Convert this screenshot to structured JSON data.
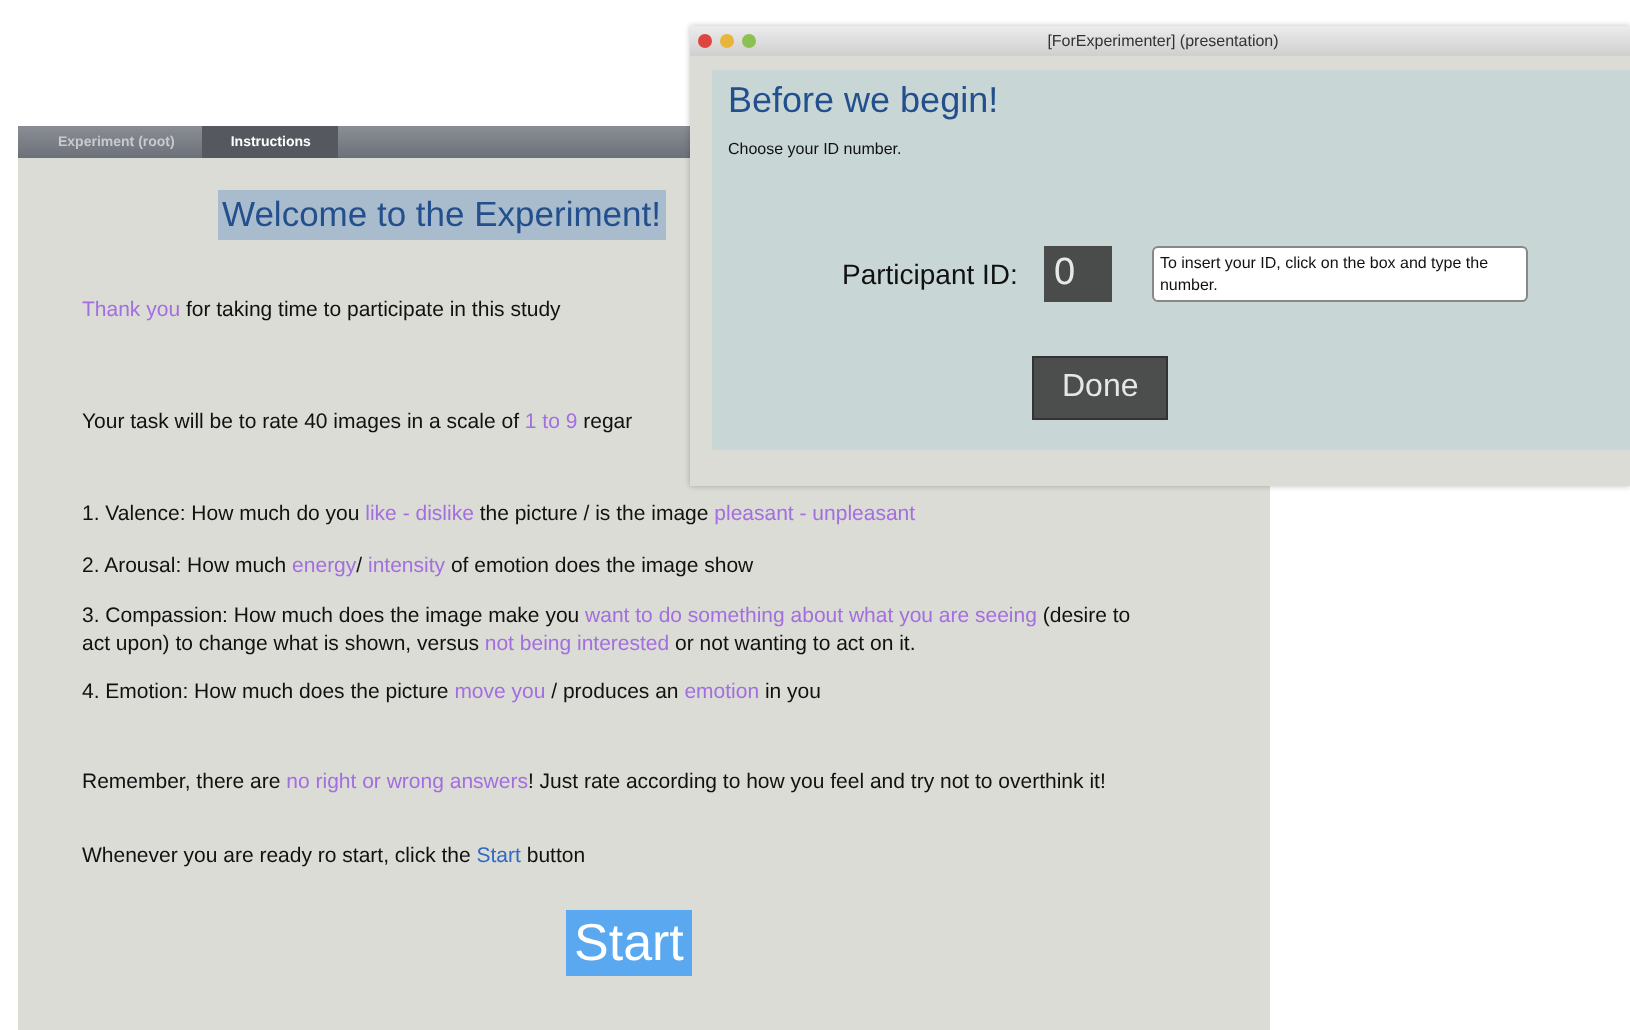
{
  "main_window": {
    "tabs": [
      {
        "label": "Experiment (root)",
        "selected": false
      },
      {
        "label": "Instructions",
        "selected": true
      }
    ],
    "heading": "Welcome to the Experiment!",
    "paragraphs": [
      {
        "segments": [
          {
            "text": "Thank you",
            "kind": "highlight"
          },
          {
            "text": " for taking time to participate in this study",
            "kind": "plain"
          }
        ]
      },
      {
        "segments": [
          {
            "text": "Your task will be to rate 40 images in a scale of ",
            "kind": "plain"
          },
          {
            "text": "1 to 9",
            "kind": "highlight"
          },
          {
            "text": " regar",
            "kind": "plain"
          }
        ]
      },
      {
        "segments": [
          {
            "text": "1. Valence: How much do you ",
            "kind": "plain"
          },
          {
            "text": "like - dislike",
            "kind": "highlight"
          },
          {
            "text": " the picture / is the image ",
            "kind": "plain"
          },
          {
            "text": "pleasant - unpleasant",
            "kind": "highlight"
          }
        ]
      },
      {
        "segments": [
          {
            "text": "2. Arousal: How much ",
            "kind": "plain"
          },
          {
            "text": "energy",
            "kind": "highlight"
          },
          {
            "text": "/ ",
            "kind": "plain"
          },
          {
            "text": "intensity",
            "kind": "highlight"
          },
          {
            "text": " of emotion does the image show",
            "kind": "plain"
          }
        ]
      },
      {
        "segments": [
          {
            "text": "3. Compassion: How much does the image make you ",
            "kind": "plain"
          },
          {
            "text": "want to do something about what you are seeing",
            "kind": "highlight"
          },
          {
            "text": " (desire to act upon) to change what is shown, versus ",
            "kind": "plain"
          },
          {
            "text": "not being interested",
            "kind": "highlight"
          },
          {
            "text": " or not wanting to act on it.",
            "kind": "plain"
          }
        ]
      },
      {
        "segments": [
          {
            "text": "4. Emotion: How much does the picture ",
            "kind": "plain"
          },
          {
            "text": "move you",
            "kind": "highlight"
          },
          {
            "text": " / produces an ",
            "kind": "plain"
          },
          {
            "text": "emotion",
            "kind": "highlight"
          },
          {
            "text": " in you",
            "kind": "plain"
          }
        ]
      },
      {
        "segments": [
          {
            "text": "Remember, there are ",
            "kind": "plain"
          },
          {
            "text": "no right or wrong answers",
            "kind": "highlight"
          },
          {
            "text": "! Just rate according to how you feel and try not to overthink it!",
            "kind": "plain"
          }
        ]
      },
      {
        "segments": [
          {
            "text": "Whenever you are ready ro start, click the ",
            "kind": "plain"
          },
          {
            "text": "Start",
            "kind": "keyword"
          },
          {
            "text": " button",
            "kind": "plain"
          }
        ]
      }
    ],
    "start_button": "Start"
  },
  "dialog": {
    "title": "[ForExperimenter] (presentation)",
    "heading": "Before we begin!",
    "instruction": "Choose your ID number.",
    "field_label": "Participant ID:",
    "field_value": "0",
    "tooltip": "To insert your ID, click on the box and type the number.",
    "done_button": "Done"
  }
}
